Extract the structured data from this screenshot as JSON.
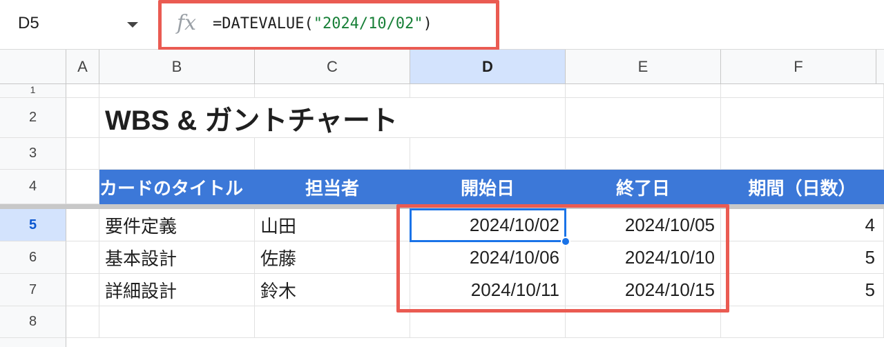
{
  "name_box": "D5",
  "formula": {
    "prefix": "=DATEVALUE(",
    "string": "\"2024/10/02\"",
    "suffix": ")"
  },
  "fx_label": "fx",
  "columns": [
    "A",
    "B",
    "C",
    "D",
    "E",
    "F"
  ],
  "rows": [
    "1",
    "2",
    "3",
    "4",
    "5",
    "6",
    "7",
    "8"
  ],
  "title": "WBS & ガントチャート",
  "headers": {
    "task": "カードのタイトル",
    "assignee": "担当者",
    "start": "開始日",
    "end": "終了日",
    "duration": "期間（日数）"
  },
  "data_rows": [
    {
      "task": "要件定義",
      "assignee": "山田",
      "start": "2024/10/02",
      "end": "2024/10/05",
      "duration": "4"
    },
    {
      "task": "基本設計",
      "assignee": "佐藤",
      "start": "2024/10/06",
      "end": "2024/10/10",
      "duration": "5"
    },
    {
      "task": "詳細設計",
      "assignee": "鈴木",
      "start": "2024/10/11",
      "end": "2024/10/15",
      "duration": "5"
    }
  ],
  "colors": {
    "header_fill": "#3c78d8",
    "highlight": "#ea5b52",
    "selection": "#1a73e8"
  }
}
